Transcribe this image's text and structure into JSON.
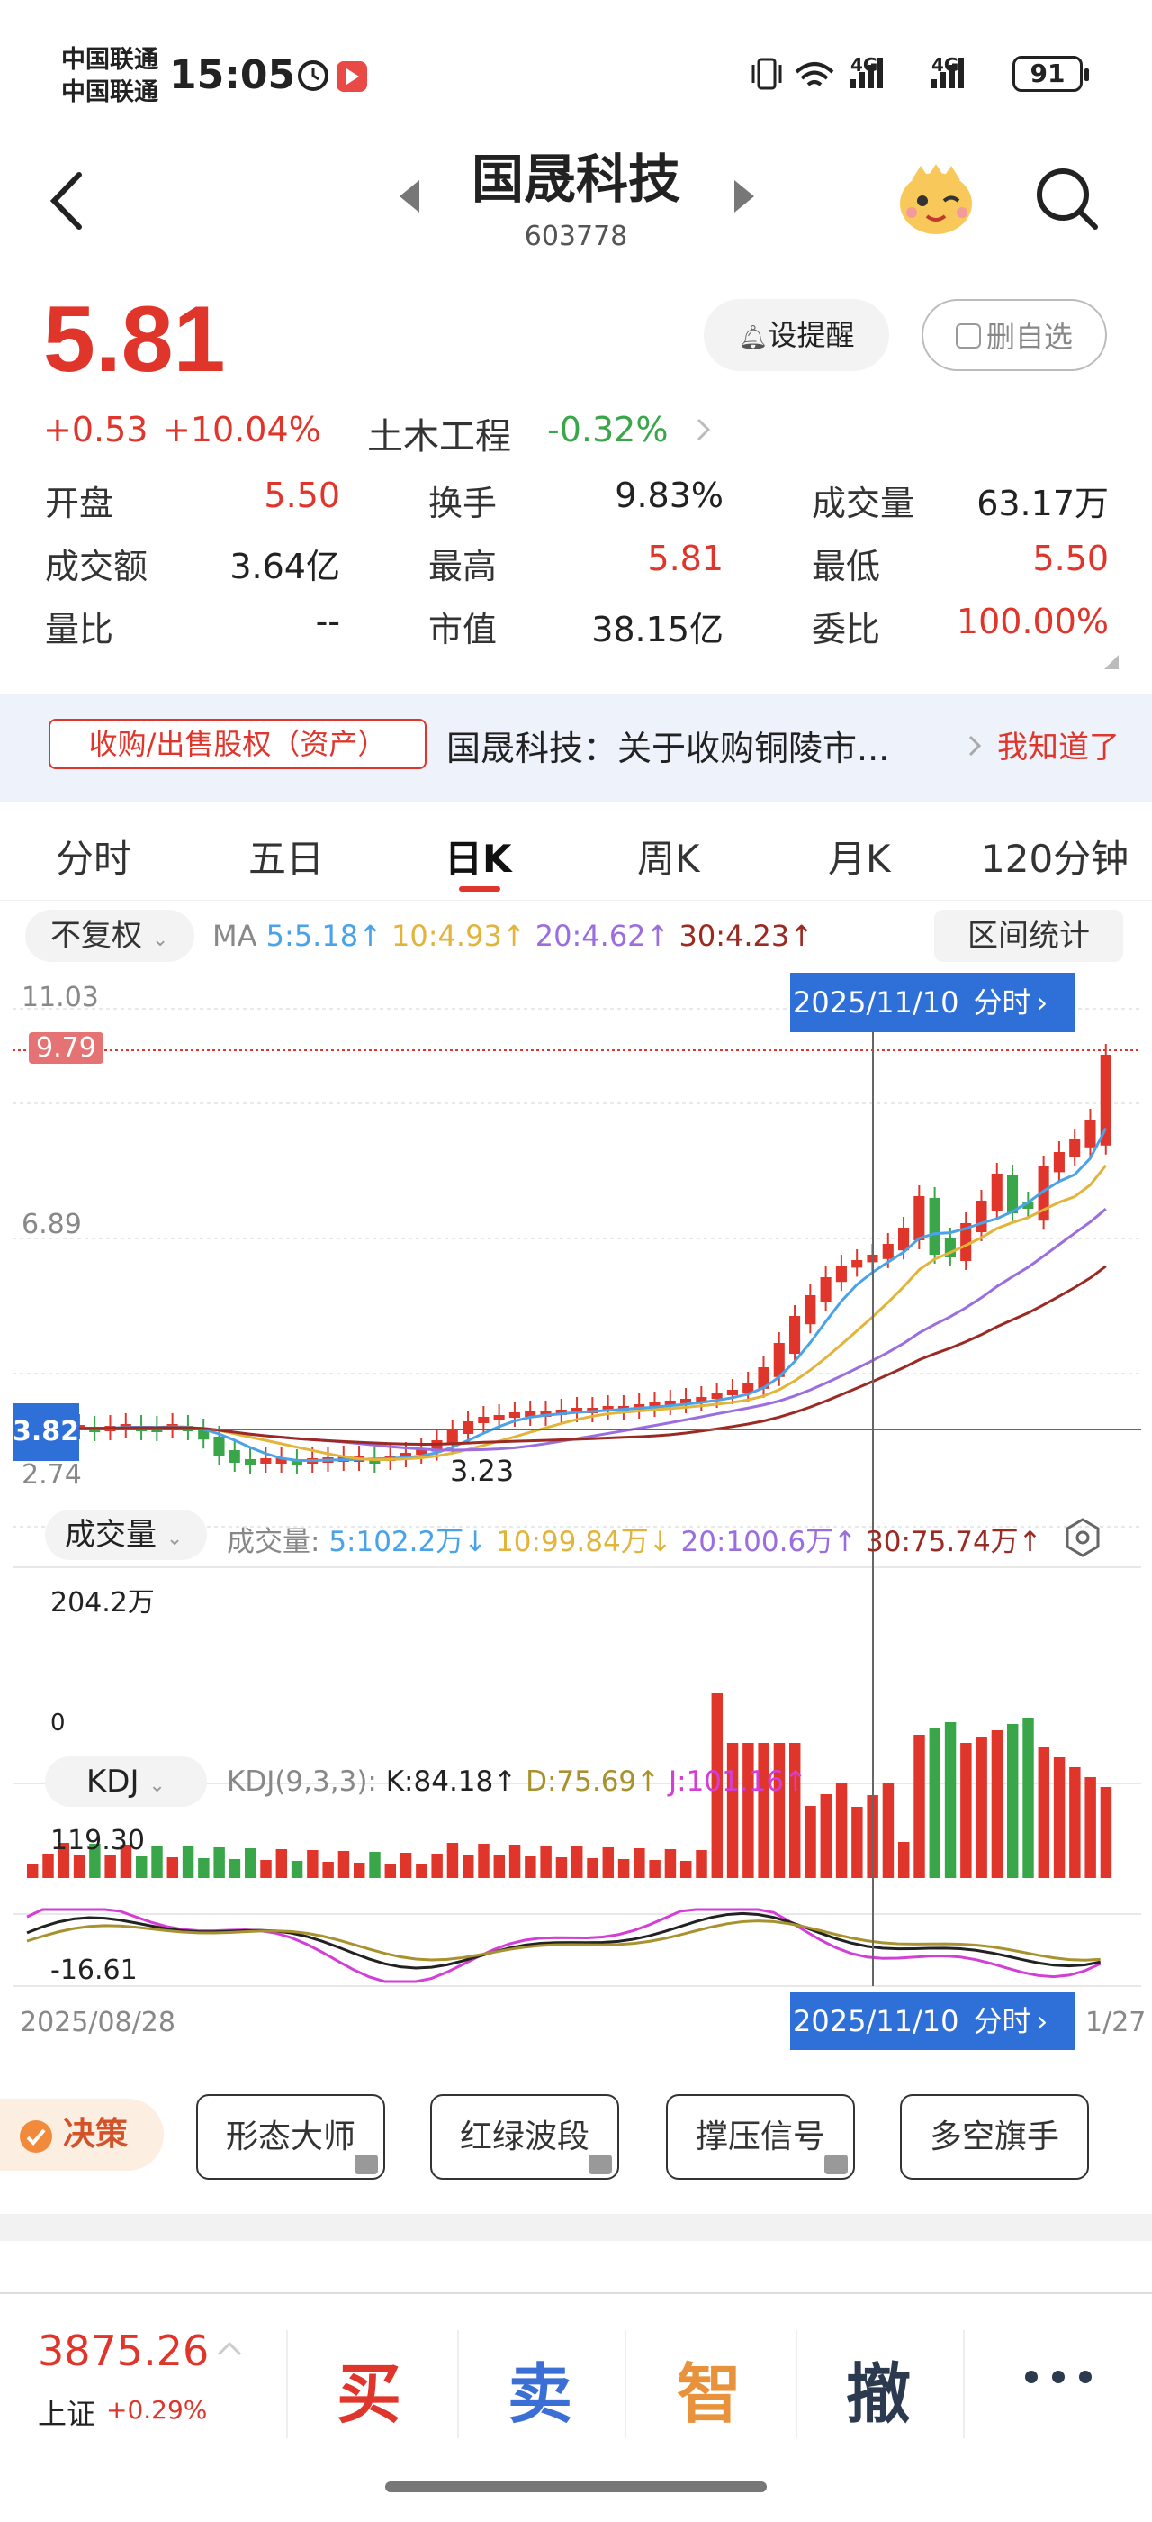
{
  "status": {
    "carrier1": "中国联通",
    "carrier2": "中国联通",
    "time": "15:05",
    "network1": "4G",
    "network2": "4G",
    "battery": "91"
  },
  "header": {
    "stock_name": "国晟科技",
    "stock_code": "603778"
  },
  "quote": {
    "price": "5.81",
    "change": "+0.53",
    "change_pct": "+10.04%",
    "sector": "土木工程",
    "sector_change": "-0.32%",
    "alert_label": "设提醒",
    "remove_watch_label": "删自选",
    "stats": [
      {
        "label": "开盘",
        "value": "5.50"
      },
      {
        "label": "换手",
        "value": "9.83%"
      },
      {
        "label": "成交量",
        "value": "63.17万"
      },
      {
        "label": "成交额",
        "value": "3.64亿"
      },
      {
        "label": "最高",
        "value": "5.81"
      },
      {
        "label": "最低",
        "value": "5.50"
      },
      {
        "label": "量比",
        "value": "--"
      },
      {
        "label": "市值",
        "value": "38.15亿"
      },
      {
        "label": "委比",
        "value": "100.00%"
      }
    ]
  },
  "notice": {
    "tag": "收购/出售股权（资产）",
    "text": "国晟科技：关于收购铜陵市...",
    "ack": "我知道了"
  },
  "tabs": [
    "分时",
    "五日",
    "日K",
    "周K",
    "月K",
    "120分钟"
  ],
  "active_tab": "日K",
  "kline": {
    "adjust": "不复权",
    "ma_label": "MA",
    "ma5": "5:5.18↑",
    "ma10": "10:4.93↑",
    "ma20": "20:4.62↑",
    "ma30": "30:4.23↑",
    "range_stats": "区间统计",
    "price_top": "11.03",
    "price_mid": "6.89",
    "price_bottom": "2.74",
    "current_marker": "9.79",
    "cross_price": "3.82",
    "low_label": "3.23",
    "cursor_date": "2025/11/10",
    "cursor_link": "分时",
    "colors": {
      "up": "#e0352b",
      "down": "#3aa64a",
      "ma5": "#4aa3e8",
      "ma10": "#e2b43a",
      "ma20": "#9b6ee0",
      "ma30": "#9a2a22"
    }
  },
  "volume": {
    "selector": "成交量",
    "label": "成交量:",
    "ma5": "5:102.2万↓",
    "ma10": "10:99.84万↓",
    "ma20": "20:100.6万↑",
    "ma30": "30:75.74万↑",
    "axis_max": "204.2万",
    "axis_zero": "0"
  },
  "kdj": {
    "selector": "KDJ",
    "label": "KDJ(9,3,3):",
    "k": "K:84.18↑",
    "d": "D:75.69↑",
    "j": "J:101.16↑",
    "axis_top": "119.30",
    "axis_bottom": "-16.61"
  },
  "xaxis": {
    "start": "2025/08/28",
    "end_partial": "1/27"
  },
  "tools": {
    "decision": "决策",
    "items": [
      "形态大师",
      "红绿波段",
      "撑压信号",
      "多空旗手"
    ]
  },
  "bottom": {
    "index_value": "3875.26",
    "index_name": "上证",
    "index_change": "+0.29%",
    "buy": "买",
    "sell": "卖",
    "smart": "智",
    "cancel": "撤"
  }
}
